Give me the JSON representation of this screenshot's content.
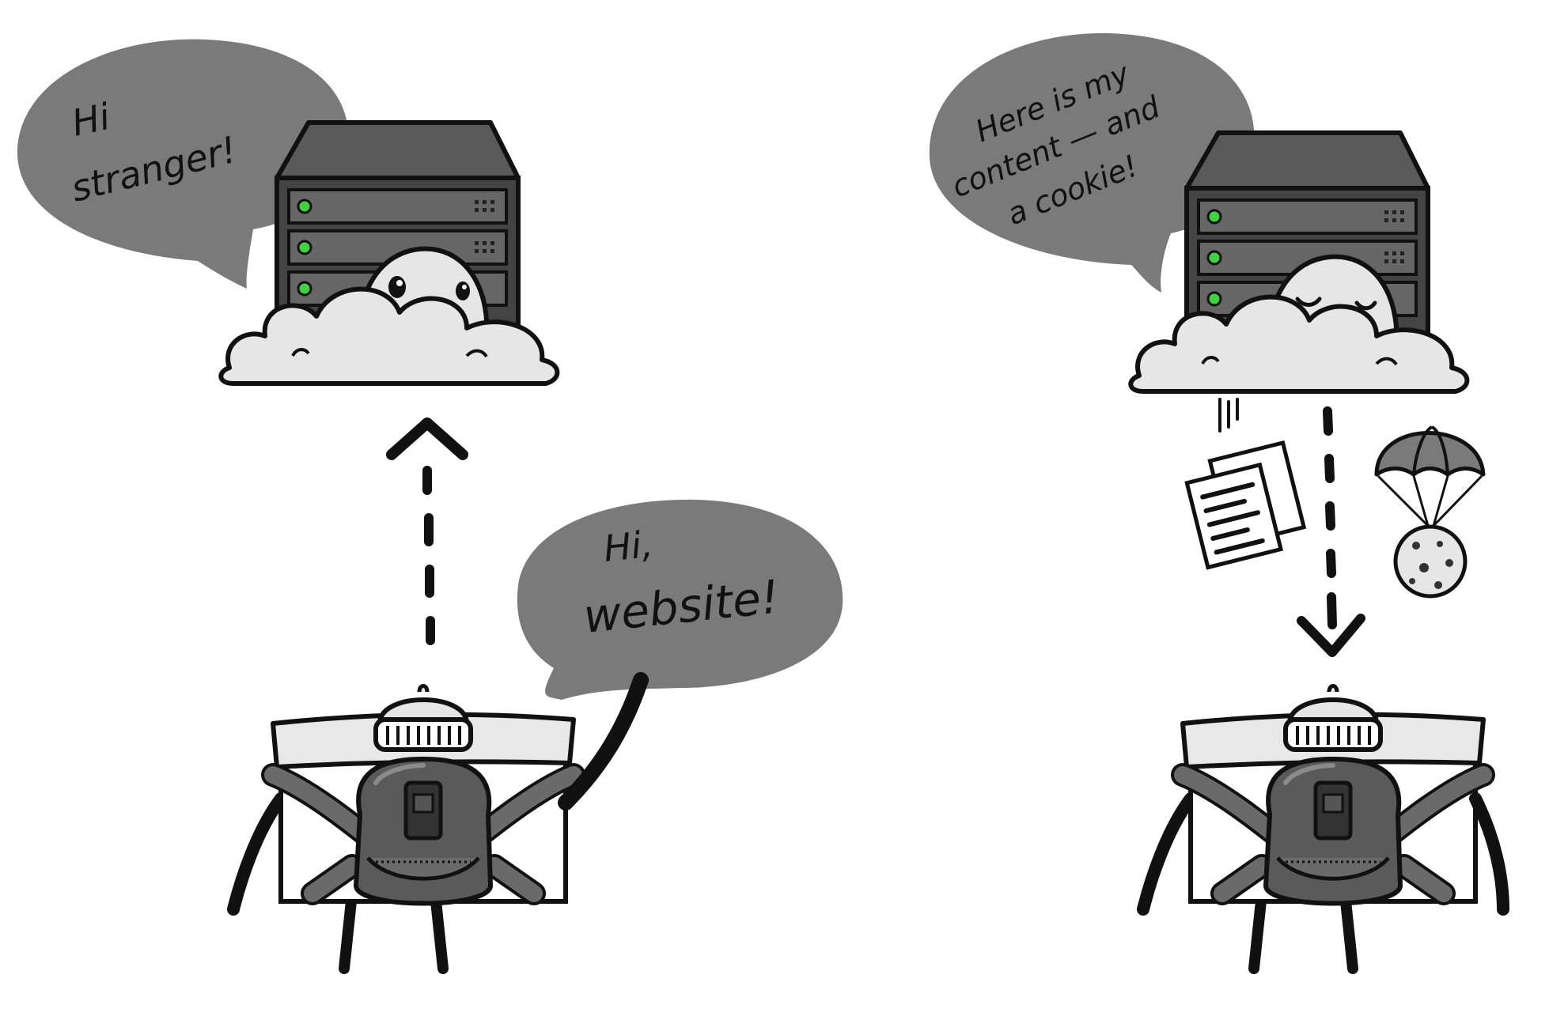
{
  "scenes": [
    {
      "server_bubble": {
        "line1": "Hi",
        "line2": "stranger!"
      },
      "browser_bubble": {
        "line1": "Hi,",
        "line2": "website!"
      },
      "request_arrow_direction": "up",
      "server_expression": "eyes-open"
    },
    {
      "server_bubble": {
        "line1": "Here is my",
        "line2": "content — and",
        "line3": "a cookie!"
      },
      "response_arrow_direction": "down",
      "server_expression": "eyes-closed",
      "delivered_items": [
        "documents",
        "cookie-parachute"
      ]
    }
  ],
  "colors": {
    "bubble": "#7a7a7a",
    "cloud": "#e6e6e6",
    "server": "#4a4a4a",
    "server_light": "#3fd13f",
    "backpack": "#5a5a5a",
    "browser_window": "#ffffff",
    "browser_bar": "#e8e8e8"
  },
  "icons": [
    "server-rack-icon",
    "cloud-icon",
    "browser-character-icon",
    "backpack-icon",
    "beanie-icon",
    "documents-icon",
    "parachute-icon",
    "cookie-icon",
    "arrow-up-icon",
    "arrow-down-icon"
  ]
}
